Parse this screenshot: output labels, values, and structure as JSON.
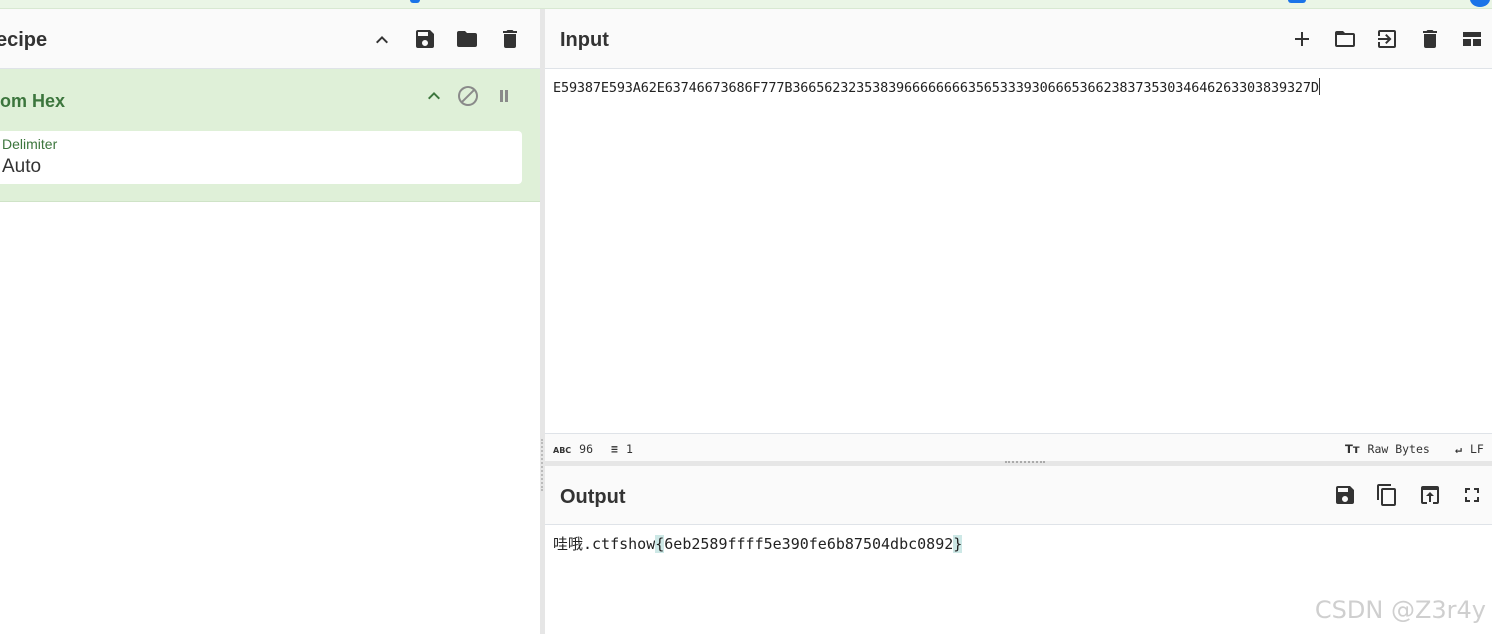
{
  "recipe": {
    "title": "ecipe",
    "operation": {
      "name": "rom Hex",
      "delimiter_label": "Delimiter",
      "delimiter_value": "Auto"
    }
  },
  "input": {
    "title": "Input",
    "text": "E59387E593A62E63746673686F777B36656232353839666666663565333930666536623837353034646263303839327D",
    "stats": {
      "length": "96",
      "lines": "1",
      "encoding": "Raw Bytes",
      "eol": "LF"
    }
  },
  "output": {
    "title": "Output",
    "prefix": "哇哦.ctfshow",
    "brace_open": "{",
    "flag": "6eb2589ffff5e390fe6b87504dbc0892",
    "brace_close": "}"
  },
  "watermark": "CSDN @Z3r4y",
  "icons": {
    "recipe_toolbar": [
      "chevron-up-icon",
      "save-icon",
      "folder-icon",
      "trash-icon"
    ],
    "operation_toolbar": [
      "chevron-up-icon",
      "disable-icon",
      "pause-icon"
    ],
    "input_toolbar": [
      "plus-icon",
      "folder-icon",
      "import-icon",
      "trash-icon",
      "layout-icon"
    ],
    "output_toolbar": [
      "save-icon",
      "copy-icon",
      "replace-input-icon",
      "fullscreen-icon"
    ]
  },
  "colors": {
    "operation_bg": "#dff0d8",
    "operation_text": "#3c763d",
    "accent": "#1a73e8"
  }
}
